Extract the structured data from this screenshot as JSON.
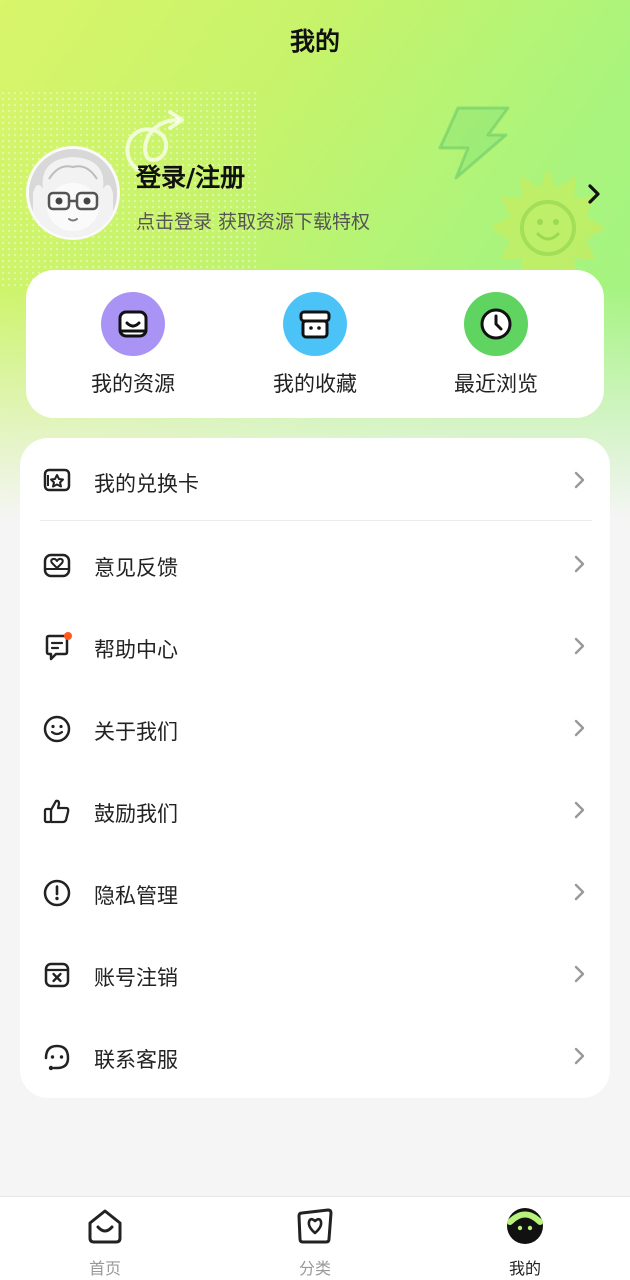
{
  "header": {
    "title": "我的"
  },
  "profile": {
    "login_title": "登录/注册",
    "login_subtitle": "点击登录 获取资源下载特权"
  },
  "quick_actions": [
    {
      "label": "我的资源",
      "icon": "tray-icon",
      "color": "#a993f5"
    },
    {
      "label": "我的收藏",
      "icon": "archive-box-icon",
      "color": "#4cc3f7"
    },
    {
      "label": "最近浏览",
      "icon": "clock-icon",
      "color": "#5fd461"
    }
  ],
  "menu": [
    {
      "label": "我的兑换卡",
      "icon": "redeem-card-icon"
    },
    {
      "label": "意见反馈",
      "icon": "feedback-icon"
    },
    {
      "label": "帮助中心",
      "icon": "help-center-icon",
      "badge_color": "#ff5a1f"
    },
    {
      "label": "关于我们",
      "icon": "smile-icon"
    },
    {
      "label": "鼓励我们",
      "icon": "thumbs-up-icon"
    },
    {
      "label": "隐私管理",
      "icon": "privacy-alert-icon"
    },
    {
      "label": "账号注销",
      "icon": "account-cancel-icon"
    },
    {
      "label": "联系客服",
      "icon": "customer-service-icon"
    }
  ],
  "tabbar": [
    {
      "label": "首页",
      "icon": "home-icon",
      "active": false
    },
    {
      "label": "分类",
      "icon": "category-icon",
      "active": false
    },
    {
      "label": "我的",
      "icon": "profile-face-icon",
      "active": true
    }
  ],
  "colors": {
    "accent_green": "#b8f27a",
    "active_tab": "#222222",
    "inactive_tab": "#999999"
  }
}
